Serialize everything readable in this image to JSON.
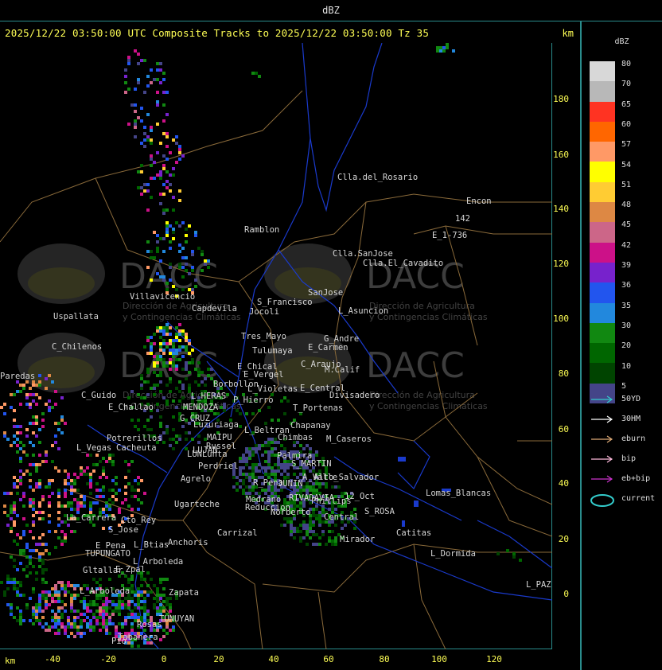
{
  "window_title": "dBZ",
  "header": {
    "text": "2025/12/22 03:50:00 UTC Composite Tracks to 2025/12/22 03:50:00 Tz 35",
    "unit": "km"
  },
  "axes": {
    "y_ticks": [
      "180",
      "160",
      "140",
      "120",
      "100",
      "80",
      "60",
      "40",
      "20",
      "0"
    ],
    "x_ticks": [
      "-40",
      "-20",
      "0",
      "20",
      "40",
      "60",
      "80",
      "100",
      "120"
    ],
    "x_unit": "km"
  },
  "legend": {
    "title": "dBZ",
    "levels": [
      {
        "value": "80",
        "color": "#d8d8d8"
      },
      {
        "value": "70",
        "color": "#b8b8b8"
      },
      {
        "value": "65",
        "color": "#ff3322"
      },
      {
        "value": "60",
        "color": "#ff6600"
      },
      {
        "value": "57",
        "color": "#ff9966"
      },
      {
        "value": "54",
        "color": "#ffff00"
      },
      {
        "value": "51",
        "color": "#ffcc33"
      },
      {
        "value": "48",
        "color": "#dd8844"
      },
      {
        "value": "45",
        "color": "#cc6688"
      },
      {
        "value": "42",
        "color": "#cc1188"
      },
      {
        "value": "39",
        "color": "#7722cc"
      },
      {
        "value": "36",
        "color": "#2255ee"
      },
      {
        "value": "35",
        "color": "#2288dd"
      },
      {
        "value": "30",
        "color": "#118811"
      },
      {
        "value": "20",
        "color": "#006600"
      },
      {
        "value": "10",
        "color": "#004400"
      },
      {
        "value": "5",
        "color": "#444488"
      }
    ],
    "tracks": [
      {
        "label": "50YD",
        "color": "#33cccc"
      },
      {
        "label": "30HM",
        "color": "#ffffff"
      },
      {
        "label": "eburn",
        "color": "#ddaa77"
      },
      {
        "label": "bip",
        "color": "#ffbbdd"
      },
      {
        "label": "eb+bip",
        "color": "#cc33cc"
      },
      {
        "label": "current",
        "color": "#33cccc"
      }
    ]
  },
  "map": {
    "watermark": {
      "text": "DACC",
      "subtitle_1": "Dirección de Agricultura",
      "subtitle_2": "y Contingencias Climáticas"
    },
    "places": [
      {
        "name": "Clla.del_Rosario"
      },
      {
        "name": "Encon"
      },
      {
        "name": "142"
      },
      {
        "name": "E_1-736"
      },
      {
        "name": "Ramblon"
      },
      {
        "name": "Clla.SanJose"
      },
      {
        "name": "Clla.El_Cavadito"
      },
      {
        "name": "Villavicencio"
      },
      {
        "name": "Capdevila"
      },
      {
        "name": "S_Francisco"
      },
      {
        "name": "Jocoli"
      },
      {
        "name": "SanJose"
      },
      {
        "name": "L_Asuncion"
      },
      {
        "name": "Uspallata"
      },
      {
        "name": "Tres_Mayo"
      },
      {
        "name": "G_Andre"
      },
      {
        "name": "E_Carmen"
      },
      {
        "name": "C_Chilenos"
      },
      {
        "name": "Tulumaya"
      },
      {
        "name": "C_Araujo"
      },
      {
        "name": "M.Calif"
      },
      {
        "name": "E_Chical"
      },
      {
        "name": "E_Vergel"
      },
      {
        "name": "Paredas"
      },
      {
        "name": "Borbollon"
      },
      {
        "name": "L_Violetas"
      },
      {
        "name": "E_Central"
      },
      {
        "name": "Divisadero"
      },
      {
        "name": "C_Guido"
      },
      {
        "name": "L_HERAS"
      },
      {
        "name": "P_Hierro"
      },
      {
        "name": "T_Portenas"
      },
      {
        "name": "E_Challao"
      },
      {
        "name": "MENDOZA"
      },
      {
        "name": "G_CRUZ"
      },
      {
        "name": "Chapanay"
      },
      {
        "name": "Luzuriaga"
      },
      {
        "name": "L_Beltran"
      },
      {
        "name": "MAIPU"
      },
      {
        "name": "Chimbas"
      },
      {
        "name": "M_Caseros"
      },
      {
        "name": "Potrerillos"
      },
      {
        "name": "Cacheuta"
      },
      {
        "name": "Russel"
      },
      {
        "name": "L_Vegas"
      },
      {
        "name": "LUJAN"
      },
      {
        "name": "LUNLunta"
      },
      {
        "name": "Perdriel"
      },
      {
        "name": "Palmira"
      },
      {
        "name": "S_MARTIN"
      },
      {
        "name": "A_Valle"
      },
      {
        "name": "Agrelo"
      },
      {
        "name": "R_Pena"
      },
      {
        "name": "JUNIN"
      },
      {
        "name": "Alto_Salvador"
      },
      {
        "name": "Ugarteche"
      },
      {
        "name": "Medrano"
      },
      {
        "name": "RIVADAVIA"
      },
      {
        "name": "12_Oct"
      },
      {
        "name": "Lomas_Blancas"
      },
      {
        "name": "Reduccion"
      },
      {
        "name": "S_ROSA"
      },
      {
        "name": "La_Carrera"
      },
      {
        "name": "Cto_Rey"
      },
      {
        "name": "Norberto"
      },
      {
        "name": "Phillips"
      },
      {
        "name": "Central"
      },
      {
        "name": "S_Jose"
      },
      {
        "name": "Carrizal"
      },
      {
        "name": "Catitas"
      },
      {
        "name": "Anchoris"
      },
      {
        "name": "E_Pena"
      },
      {
        "name": "L_Btias"
      },
      {
        "name": "Mirador"
      },
      {
        "name": "L_Dormida"
      },
      {
        "name": "TUPUNGATO"
      },
      {
        "name": "L_Arboleda"
      },
      {
        "name": "E_Zpal"
      },
      {
        "name": "Gltallar"
      },
      {
        "name": "L_Arboleda"
      },
      {
        "name": "Zapata"
      },
      {
        "name": "L_PAZ"
      },
      {
        "name": "TUNUYAN"
      },
      {
        "name": "Rosas"
      },
      {
        "name": "Tabanera"
      },
      {
        "name": "Pio"
      }
    ]
  }
}
